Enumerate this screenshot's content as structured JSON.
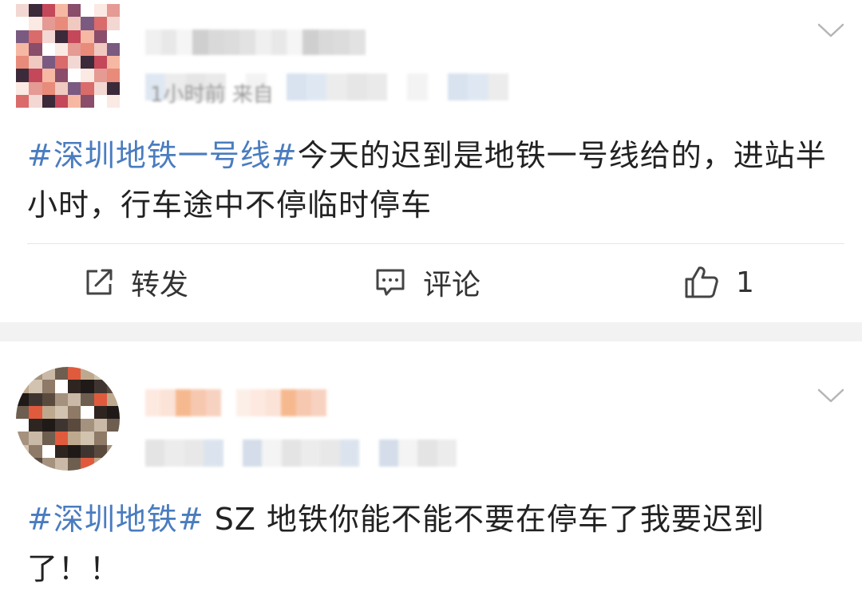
{
  "posts": [
    {
      "hashtag": "#深圳地铁一号线#",
      "body": "今天的迟到是地铁一号线给的，进站半小时，行车途中不停临时停车",
      "meta_visible": "1小时前  来自",
      "actions": {
        "repost_label": "转发",
        "comment_label": "评论",
        "like_count": "1"
      }
    },
    {
      "hashtag": "#深圳地铁#",
      "body": " SZ 地铁你能不能不要在停车了我要迟到了！！"
    }
  ],
  "colors": {
    "hashtag": "#4a7cbf",
    "text": "#222222",
    "separator": "#f2f2f2"
  },
  "icons": {
    "repost": "repost-icon",
    "comment": "comment-icon",
    "like": "thumbs-up-icon",
    "menu": "chevron-down-icon"
  }
}
